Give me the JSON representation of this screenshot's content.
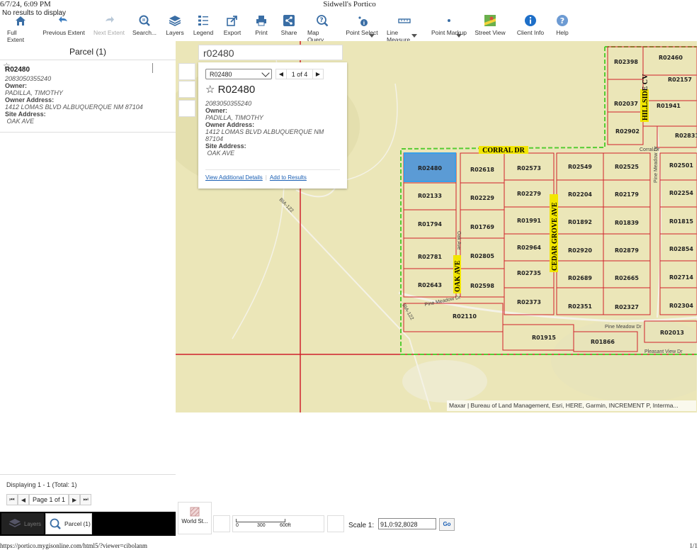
{
  "print_header": {
    "date": "6/7/24, 6:09 PM",
    "title": "Sidwell's Portico"
  },
  "status": {
    "no_results": "No results to display"
  },
  "toolbar": [
    {
      "label": "Full Extent",
      "icon": "home-icon"
    },
    {
      "label": "Previous Extent",
      "icon": "back-arrow-icon"
    },
    {
      "label": "Next Extent",
      "icon": "forward-arrow-icon"
    },
    {
      "label": "Search...",
      "icon": "search-icon"
    },
    {
      "label": "Layers",
      "icon": "layers-icon"
    },
    {
      "label": "Legend",
      "icon": "legend-icon"
    },
    {
      "label": "Export",
      "icon": "export-icon"
    },
    {
      "label": "Print",
      "icon": "print-icon"
    },
    {
      "label": "Share",
      "icon": "share-icon"
    },
    {
      "label": "Map Query",
      "icon": "query-icon"
    },
    {
      "label": "Point Select",
      "icon": "point-select-icon"
    },
    {
      "label": "Line Measure",
      "icon": "ruler-icon"
    },
    {
      "label": "Point Markup",
      "icon": "markup-dot-icon"
    },
    {
      "label": "Street View",
      "icon": "street-view-icon"
    },
    {
      "label": "Client Info",
      "icon": "info-icon"
    },
    {
      "label": "Help",
      "icon": "help-icon"
    }
  ],
  "panel": {
    "title": "Parcel (1)",
    "result": {
      "parcel_id": "R02480",
      "parcel_number": "2083050355240",
      "owner_label": "Owner:",
      "owner": "PADILLA, TIMOTHY",
      "owner_address_label": "Owner Address:",
      "owner_address": "1412 LOMAS BLVD ALBUQUERQUE NM 87104",
      "site_address_label": "Site Address:",
      "site_address": " OAK AVE"
    },
    "displaying": "Displaying 1 - 1 (Total: 1)",
    "page_text": "Page 1 of 1",
    "tabs": {
      "layers": "Layers",
      "parcel": "Parcel (1)"
    }
  },
  "map": {
    "search_value": "r02480",
    "popup": {
      "selected": "R02480",
      "nav_text": "1 of 4",
      "title": "R02480",
      "parcel_number": "2083050355240",
      "owner_label": "Owner:",
      "owner": "PADILLA, TIMOTHY",
      "owner_address_label": "Owner Address:",
      "owner_address_1": "1412 LOMAS BLVD ALBUQUERQUE NM",
      "owner_address_2": "87104",
      "site_address_label": "Site Address:",
      "site_address": " OAK AVE",
      "link_details": "View Additional Details",
      "link_add": "Add to Results"
    },
    "attribution": "Maxar | Bureau of Land Management, Esri, HERE, Garmin, INCREMENT P, Interma...",
    "roads": {
      "corral": "CORRAL DR",
      "corral_small": "Corral Dr",
      "hillside": "HILLSIDE CV",
      "cedar_grove": "CEDAR GROVE AVE",
      "oak": "OAK AVE",
      "oak_small": "Oak Ave",
      "pine_meadow": "Pine Meadow Dr",
      "pine_meadow_2": "Pine Meadow Dr",
      "pleasant": "Pleasant View Dr",
      "bia1": "BIA-122",
      "bia2": "BIA-122",
      "pine_meadow_v": "Pine Meadow Dr"
    },
    "parcels": [
      "R02460",
      "R02398",
      "R02157",
      "R02037",
      "R01941",
      "R02902",
      "R02831",
      "R02480",
      "R02618",
      "R02573",
      "R02549",
      "R02525",
      "R02501",
      "R02133",
      "R02229",
      "R02279",
      "R02204",
      "R02179",
      "R02254",
      "R01794",
      "R01769",
      "R01991",
      "R01892",
      "R01839",
      "R01815",
      "R02781",
      "R02805",
      "R02964",
      "R02920",
      "R02879",
      "R02854",
      "R02643",
      "R02598",
      "R02735",
      "R02689",
      "R02665",
      "R02714",
      "R02373",
      "R02351",
      "R02327",
      "R02304",
      "R02110",
      "R01915",
      "R01866",
      "R02013"
    ],
    "colors": {
      "highlight": "#5b9bd5",
      "parcel_line": "#d0202a",
      "boundary": "#55cc33",
      "road_label_bg": "#f2e600"
    }
  },
  "bottom": {
    "basemap": "World St...",
    "scalebar_ticks": [
      "0",
      "300",
      "600ft"
    ],
    "scale_label": "Scale 1:",
    "scale_value": "91,0:92,8028",
    "go": "Go"
  },
  "print_footer": {
    "url": "https://portico.mygisonline.com/html5/?viewer=cibolanm",
    "page": "1/1"
  }
}
